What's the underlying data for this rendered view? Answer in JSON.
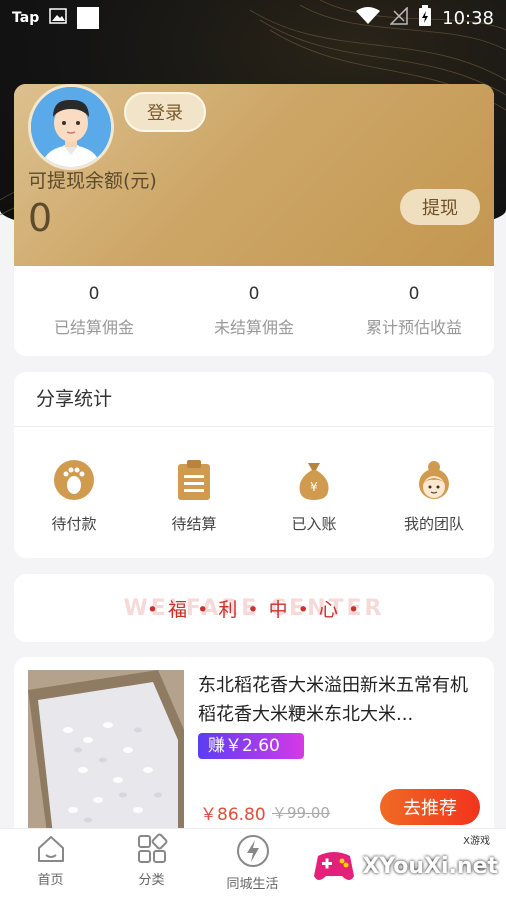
{
  "status_bar": {
    "carrier": "Tap",
    "time": "10:38"
  },
  "wallet": {
    "login_label": "登录",
    "balance_label": "可提现余额(元)",
    "balance_value": "0",
    "withdraw_label": "提现",
    "stats": [
      {
        "value": "0",
        "label": "已结算佣金"
      },
      {
        "value": "0",
        "label": "未结算佣金"
      },
      {
        "value": "0",
        "label": "累计预估收益"
      }
    ]
  },
  "share": {
    "title": "分享统计",
    "items": [
      {
        "label": "待付款",
        "icon": "footprint-icon"
      },
      {
        "label": "待结算",
        "icon": "clipboard-icon"
      },
      {
        "label": "已入账",
        "icon": "money-bag-icon"
      },
      {
        "label": "我的团队",
        "icon": "team-icon"
      }
    ]
  },
  "welfare": {
    "bg_text": "WELFARE CENTER",
    "title": "• 福 • 利 • 中 • 心 •"
  },
  "product": {
    "title": "东北稻花香大米溢田新米五常有机稻花香大米粳米东北大米...",
    "earn": "赚￥2.60",
    "price": "￥86.80",
    "original_price": "￥99.00",
    "recommend_label": "去推荐"
  },
  "nav": {
    "items": [
      {
        "label": "首页",
        "icon": "home-icon"
      },
      {
        "label": "分类",
        "icon": "category-icon"
      },
      {
        "label": "同城生活",
        "icon": "lightning-icon"
      }
    ]
  },
  "watermark": {
    "text": "XYouXi.net",
    "small": "X游戏"
  },
  "colors": {
    "gold": "#cda667",
    "accent_red": "#f2331c",
    "price_red": "#e24e3a"
  }
}
